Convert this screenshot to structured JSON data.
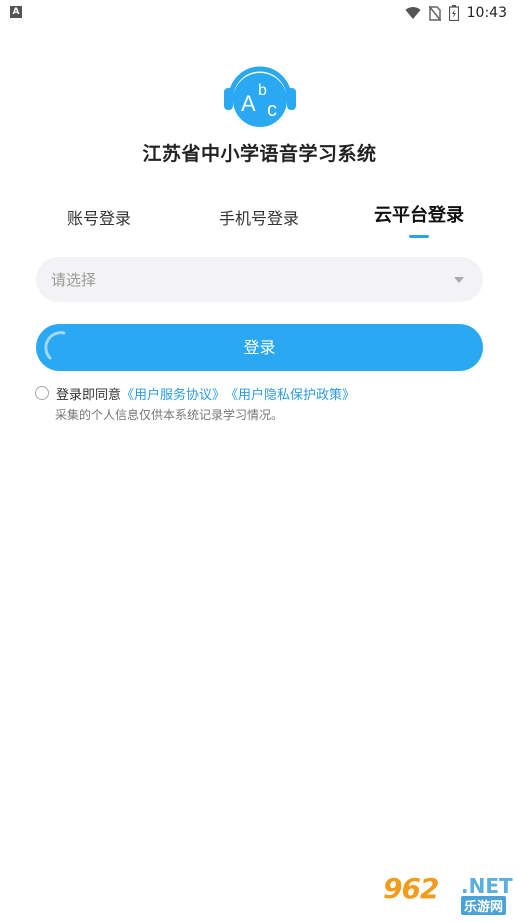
{
  "status_bar": {
    "app_icon_glyph": "A",
    "time": "10:43",
    "icons": [
      "wifi-icon",
      "no-sim-icon",
      "battery-icon"
    ]
  },
  "app": {
    "logo_text_a": "A",
    "logo_text_b": "b",
    "logo_text_c": "c",
    "title": "江苏省中小学语音学习系统"
  },
  "tabs": [
    {
      "label": "账号登录",
      "active": false
    },
    {
      "label": "手机号登录",
      "active": false
    },
    {
      "label": "云平台登录",
      "active": true
    }
  ],
  "form": {
    "select_placeholder": "请选择",
    "login_label": "登录"
  },
  "agreement": {
    "prefix": "登录即同意",
    "link1": "《用户服务协议》",
    "link2": "《用户隐私保护政策》",
    "notice": "采集的个人信息仅供本系统记录学习情况。",
    "checked": false
  },
  "watermark": {
    "number": "962",
    "net": ".NET",
    "sub": "乐游网"
  },
  "colors": {
    "accent": "#2aa8f2",
    "link": "#2a9ce8",
    "input_bg": "#f3f3f5"
  }
}
